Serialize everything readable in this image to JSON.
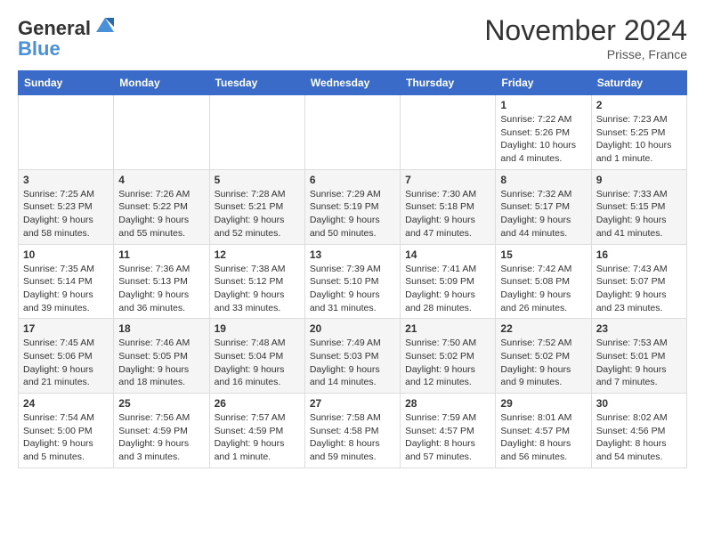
{
  "header": {
    "logo_line1": "General",
    "logo_line2": "Blue",
    "month": "November 2024",
    "location": "Prisse, France"
  },
  "days_of_week": [
    "Sunday",
    "Monday",
    "Tuesday",
    "Wednesday",
    "Thursday",
    "Friday",
    "Saturday"
  ],
  "weeks": [
    [
      {
        "day": "",
        "info": ""
      },
      {
        "day": "",
        "info": ""
      },
      {
        "day": "",
        "info": ""
      },
      {
        "day": "",
        "info": ""
      },
      {
        "day": "",
        "info": ""
      },
      {
        "day": "1",
        "info": "Sunrise: 7:22 AM\nSunset: 5:26 PM\nDaylight: 10 hours and 4 minutes."
      },
      {
        "day": "2",
        "info": "Sunrise: 7:23 AM\nSunset: 5:25 PM\nDaylight: 10 hours and 1 minute."
      }
    ],
    [
      {
        "day": "3",
        "info": "Sunrise: 7:25 AM\nSunset: 5:23 PM\nDaylight: 9 hours and 58 minutes."
      },
      {
        "day": "4",
        "info": "Sunrise: 7:26 AM\nSunset: 5:22 PM\nDaylight: 9 hours and 55 minutes."
      },
      {
        "day": "5",
        "info": "Sunrise: 7:28 AM\nSunset: 5:21 PM\nDaylight: 9 hours and 52 minutes."
      },
      {
        "day": "6",
        "info": "Sunrise: 7:29 AM\nSunset: 5:19 PM\nDaylight: 9 hours and 50 minutes."
      },
      {
        "day": "7",
        "info": "Sunrise: 7:30 AM\nSunset: 5:18 PM\nDaylight: 9 hours and 47 minutes."
      },
      {
        "day": "8",
        "info": "Sunrise: 7:32 AM\nSunset: 5:17 PM\nDaylight: 9 hours and 44 minutes."
      },
      {
        "day": "9",
        "info": "Sunrise: 7:33 AM\nSunset: 5:15 PM\nDaylight: 9 hours and 41 minutes."
      }
    ],
    [
      {
        "day": "10",
        "info": "Sunrise: 7:35 AM\nSunset: 5:14 PM\nDaylight: 9 hours and 39 minutes."
      },
      {
        "day": "11",
        "info": "Sunrise: 7:36 AM\nSunset: 5:13 PM\nDaylight: 9 hours and 36 minutes."
      },
      {
        "day": "12",
        "info": "Sunrise: 7:38 AM\nSunset: 5:12 PM\nDaylight: 9 hours and 33 minutes."
      },
      {
        "day": "13",
        "info": "Sunrise: 7:39 AM\nSunset: 5:10 PM\nDaylight: 9 hours and 31 minutes."
      },
      {
        "day": "14",
        "info": "Sunrise: 7:41 AM\nSunset: 5:09 PM\nDaylight: 9 hours and 28 minutes."
      },
      {
        "day": "15",
        "info": "Sunrise: 7:42 AM\nSunset: 5:08 PM\nDaylight: 9 hours and 26 minutes."
      },
      {
        "day": "16",
        "info": "Sunrise: 7:43 AM\nSunset: 5:07 PM\nDaylight: 9 hours and 23 minutes."
      }
    ],
    [
      {
        "day": "17",
        "info": "Sunrise: 7:45 AM\nSunset: 5:06 PM\nDaylight: 9 hours and 21 minutes."
      },
      {
        "day": "18",
        "info": "Sunrise: 7:46 AM\nSunset: 5:05 PM\nDaylight: 9 hours and 18 minutes."
      },
      {
        "day": "19",
        "info": "Sunrise: 7:48 AM\nSunset: 5:04 PM\nDaylight: 9 hours and 16 minutes."
      },
      {
        "day": "20",
        "info": "Sunrise: 7:49 AM\nSunset: 5:03 PM\nDaylight: 9 hours and 14 minutes."
      },
      {
        "day": "21",
        "info": "Sunrise: 7:50 AM\nSunset: 5:02 PM\nDaylight: 9 hours and 12 minutes."
      },
      {
        "day": "22",
        "info": "Sunrise: 7:52 AM\nSunset: 5:02 PM\nDaylight: 9 hours and 9 minutes."
      },
      {
        "day": "23",
        "info": "Sunrise: 7:53 AM\nSunset: 5:01 PM\nDaylight: 9 hours and 7 minutes."
      }
    ],
    [
      {
        "day": "24",
        "info": "Sunrise: 7:54 AM\nSunset: 5:00 PM\nDaylight: 9 hours and 5 minutes."
      },
      {
        "day": "25",
        "info": "Sunrise: 7:56 AM\nSunset: 4:59 PM\nDaylight: 9 hours and 3 minutes."
      },
      {
        "day": "26",
        "info": "Sunrise: 7:57 AM\nSunset: 4:59 PM\nDaylight: 9 hours and 1 minute."
      },
      {
        "day": "27",
        "info": "Sunrise: 7:58 AM\nSunset: 4:58 PM\nDaylight: 8 hours and 59 minutes."
      },
      {
        "day": "28",
        "info": "Sunrise: 7:59 AM\nSunset: 4:57 PM\nDaylight: 8 hours and 57 minutes."
      },
      {
        "day": "29",
        "info": "Sunrise: 8:01 AM\nSunset: 4:57 PM\nDaylight: 8 hours and 56 minutes."
      },
      {
        "day": "30",
        "info": "Sunrise: 8:02 AM\nSunset: 4:56 PM\nDaylight: 8 hours and 54 minutes."
      }
    ]
  ]
}
